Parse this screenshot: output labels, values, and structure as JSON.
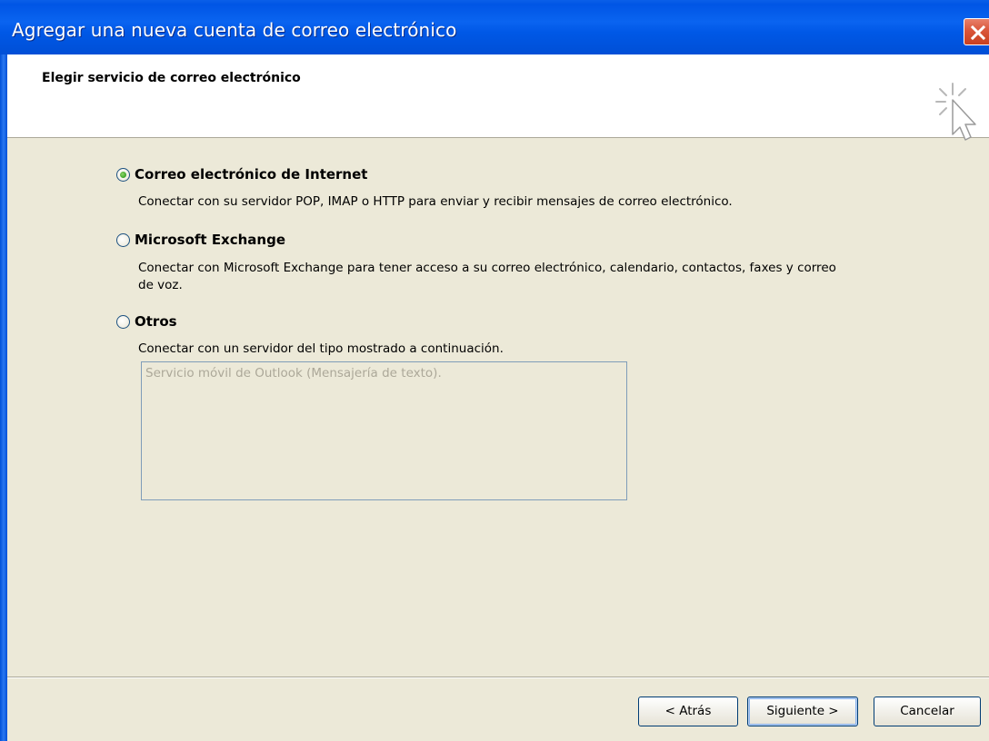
{
  "window": {
    "title": "Agregar una nueva cuenta de correo electrónico"
  },
  "header": {
    "title": "Elegir servicio de correo electrónico",
    "icon": "wizard-cursor-icon"
  },
  "options": [
    {
      "label": "Correo electrónico de Internet",
      "description": "Conectar con su servidor POP, IMAP o HTTP para enviar y recibir mensajes de correo electrónico.",
      "selected": true
    },
    {
      "label": "Microsoft Exchange",
      "description_line1": "Conectar con Microsoft Exchange para tener acceso a su correo electrónico, calendario, contactos, faxes y correo",
      "description_line2": "de voz.",
      "selected": false
    },
    {
      "label": "Otros",
      "description": "Conectar con un servidor del tipo mostrado a continuación.",
      "selected": false,
      "list_items": [
        "Servicio móvil de Outlook (Mensajería de texto)."
      ]
    }
  ],
  "buttons": {
    "back": "< Atrás",
    "next": "Siguiente >",
    "cancel": "Cancelar"
  },
  "colors": {
    "titlebar": "#0058e6",
    "dialog_bg": "#ece9d8",
    "radio_selected": "#3aa425",
    "disabled_text": "#aca899"
  }
}
